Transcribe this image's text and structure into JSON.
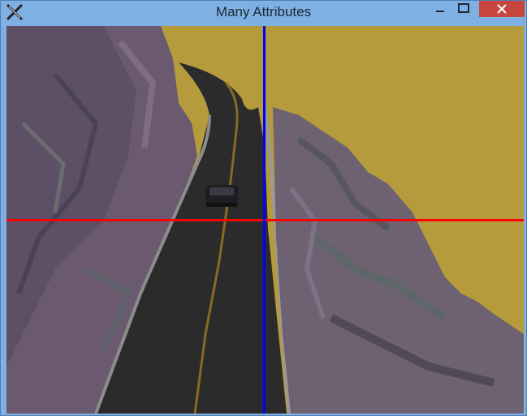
{
  "window": {
    "title": "Many Attributes",
    "buttons": {
      "minimize": "minimize",
      "maximize": "maximize",
      "close": "close"
    }
  },
  "scene": {
    "sky_color": "#b59b3b",
    "road_color": "#2a2a2a",
    "center_line_color": "#8a6a22",
    "edge_line_color": "#8c8c8c",
    "rock_color": "#6c5a70",
    "crosshair": {
      "horizontal_color": "#ff0000",
      "vertical_color": "#0000ff"
    }
  },
  "icons": {
    "app": "x-app-icon",
    "minimize": "minimize-icon",
    "maximize": "maximize-icon",
    "close": "close-icon"
  }
}
